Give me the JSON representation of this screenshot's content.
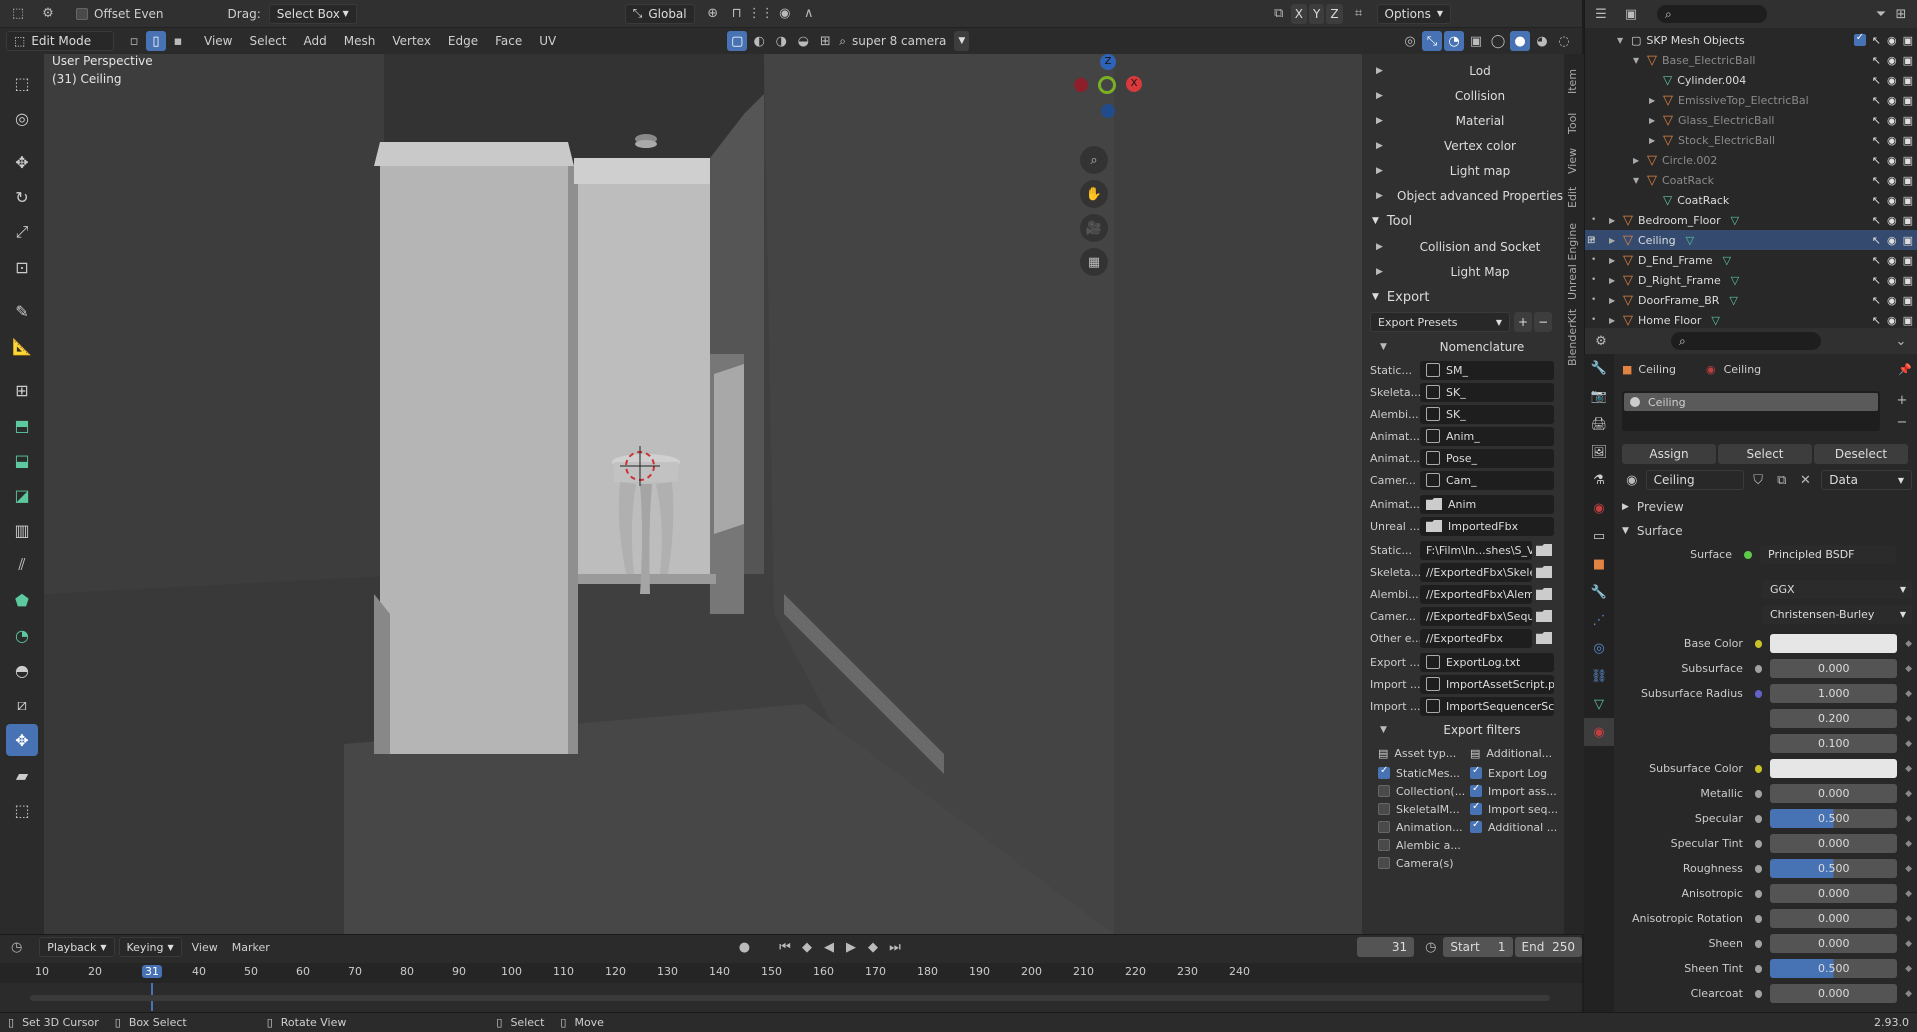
{
  "header": {
    "offset_even": "Offset Even",
    "drag_label": "Drag:",
    "drag_value": "Select Box",
    "transform_orientation": "Global",
    "options": "Options",
    "xyz": [
      "X",
      "Y",
      "Z"
    ]
  },
  "header2": {
    "mode": "Edit Mode",
    "menus": [
      "View",
      "Select",
      "Add",
      "Mesh",
      "Vertex",
      "Edge",
      "Face",
      "UV"
    ],
    "camera": "super 8 camera"
  },
  "viewport": {
    "perspective": "User Perspective",
    "object": "(31) Ceiling"
  },
  "gizmo": {
    "x": "X",
    "y": "Y",
    "z": "Z"
  },
  "npanel": {
    "top_items": [
      "Lod",
      "Collision",
      "Material",
      "Vertex color",
      "Light map",
      "Object advanced Properties"
    ],
    "tool_header": "Tool",
    "tool_items": [
      "Collision and Socket",
      "Light Map"
    ],
    "export_header": "Export",
    "export_presets": "Export Presets",
    "nomenclature": "Nomenclature",
    "prefix_fields": [
      {
        "label": "Static...",
        "value": "SM_"
      },
      {
        "label": "Skeleta...",
        "value": "SK_"
      },
      {
        "label": "Alembi...",
        "value": "SK_"
      },
      {
        "label": "Animat...",
        "value": "Anim_"
      },
      {
        "label": "Animat...",
        "value": "Pose_"
      },
      {
        "label": "Camer...",
        "value": "Cam_"
      }
    ],
    "folder_fields": [
      {
        "label": "Animat...",
        "value": "Anim"
      },
      {
        "label": "Unreal ...",
        "value": "ImportedFbx"
      }
    ],
    "path_fields": [
      {
        "label": "Static...",
        "value": "F:\\Film\\In...shes\\S_V3\\"
      },
      {
        "label": "Skeleta...",
        "value": "//ExportedFbx\\Skele..."
      },
      {
        "label": "Alembi...",
        "value": "//ExportedFbx\\Alem..."
      },
      {
        "label": "Camer...",
        "value": "//ExportedFbx\\Sequ..."
      },
      {
        "label": "Other e...",
        "value": "//ExportedFbx"
      }
    ],
    "file_fields": [
      {
        "label": "Export ...",
        "value": "ExportLog.txt"
      },
      {
        "label": "Import ...",
        "value": "ImportAssetScript.py"
      },
      {
        "label": "Import ...",
        "value": "ImportSequencerSc..."
      }
    ],
    "export_filters": "Export filters",
    "asset_type": "Asset typ...",
    "additional": "Additional...",
    "filters_left": [
      {
        "label": "StaticMes...",
        "on": true
      },
      {
        "label": "Collection(...",
        "on": false
      },
      {
        "label": "SkeletalM...",
        "on": false
      },
      {
        "label": "Animation...",
        "on": false
      },
      {
        "label": "Alembic a...",
        "on": false
      },
      {
        "label": "Camera(s)",
        "on": false
      }
    ],
    "filters_right": [
      {
        "label": "Export Log",
        "on": true
      },
      {
        "label": "Import ass...",
        "on": true
      },
      {
        "label": "Import seq...",
        "on": true
      },
      {
        "label": "Additional ...",
        "on": true
      }
    ]
  },
  "ntabs": [
    "Item",
    "Tool",
    "View",
    "Edit",
    "Unreal Engine",
    "BlenderKit"
  ],
  "outliner": {
    "rows": [
      {
        "name": "SKP Mesh Objects",
        "indent": 2,
        "type": "collection"
      },
      {
        "name": "Base_ElectricBall",
        "indent": 3,
        "type": "obj",
        "dim": true
      },
      {
        "name": "Cylinder.004",
        "indent": 4,
        "type": "mesh"
      },
      {
        "name": "EmissiveTop_ElectricBal",
        "indent": 4,
        "type": "obj",
        "dim": true
      },
      {
        "name": "Glass_ElectricBall",
        "indent": 4,
        "type": "obj",
        "dim": true
      },
      {
        "name": "Stock_ElectricBall",
        "indent": 4,
        "type": "obj",
        "dim": true
      },
      {
        "name": "Circle.002",
        "indent": 3,
        "type": "obj",
        "dim": true
      },
      {
        "name": "CoatRack",
        "indent": 3,
        "type": "obj",
        "dim": true
      },
      {
        "name": "CoatRack",
        "indent": 4,
        "type": "mesh"
      },
      {
        "name": "Bedroom_Floor",
        "indent": 1,
        "type": "obj"
      },
      {
        "name": "Ceiling",
        "indent": 1,
        "type": "obj",
        "selected": true
      },
      {
        "name": "D_End_Frame",
        "indent": 1,
        "type": "obj"
      },
      {
        "name": "D_Right_Frame",
        "indent": 1,
        "type": "obj"
      },
      {
        "name": "DoorFrame_BR",
        "indent": 1,
        "type": "obj"
      },
      {
        "name": "Home Floor",
        "indent": 1,
        "type": "obj"
      }
    ]
  },
  "props": {
    "breadcrumb_obj": "Ceiling",
    "breadcrumb_mat": "Ceiling",
    "slot": "Ceiling",
    "assign": "Assign",
    "select": "Select",
    "deselect": "Deselect",
    "material_name": "Ceiling",
    "link": "Data",
    "preview": "Preview",
    "surface_header": "Surface",
    "surface_label": "Surface",
    "surface_value": "Principled BSDF",
    "distribution": "GGX",
    "subsurface_method": "Christensen-Burley",
    "rows": [
      {
        "label": "Base Color",
        "value": "",
        "kind": "white",
        "dot": "#c7c229"
      },
      {
        "label": "Subsurface",
        "value": "0.000",
        "kind": "num",
        "dot": "#a1a1a1"
      },
      {
        "label": "Subsurface Radius",
        "value": "1.000",
        "kind": "num",
        "dot": "#6363c7"
      },
      {
        "label": "",
        "value": "0.200",
        "kind": "num",
        "dot": ""
      },
      {
        "label": "",
        "value": "0.100",
        "kind": "num",
        "dot": ""
      },
      {
        "label": "Subsurface Color",
        "value": "",
        "kind": "white",
        "dot": "#c7c229"
      },
      {
        "label": "Metallic",
        "value": "0.000",
        "kind": "num",
        "dot": "#a1a1a1"
      },
      {
        "label": "Specular",
        "value": "0.500",
        "kind": "blue",
        "dot": "#a1a1a1"
      },
      {
        "label": "Specular Tint",
        "value": "0.000",
        "kind": "num",
        "dot": "#a1a1a1"
      },
      {
        "label": "Roughness",
        "value": "0.500",
        "kind": "blue",
        "dot": "#a1a1a1"
      },
      {
        "label": "Anisotropic",
        "value": "0.000",
        "kind": "num",
        "dot": "#a1a1a1"
      },
      {
        "label": "Anisotropic Rotation",
        "value": "0.000",
        "kind": "num",
        "dot": "#a1a1a1"
      },
      {
        "label": "Sheen",
        "value": "0.000",
        "kind": "num",
        "dot": "#a1a1a1"
      },
      {
        "label": "Sheen Tint",
        "value": "0.500",
        "kind": "blue",
        "dot": "#a1a1a1"
      },
      {
        "label": "Clearcoat",
        "value": "0.000",
        "kind": "num",
        "dot": "#a1a1a1"
      }
    ]
  },
  "timeline": {
    "menus": [
      "Playback",
      "Keying",
      "View",
      "Marker"
    ],
    "current": "31",
    "start_label": "Start",
    "start": "1",
    "end_label": "End",
    "end": "250",
    "ruler": [
      "10",
      "20",
      "31",
      "40",
      "50",
      "60",
      "70",
      "80",
      "90",
      "100",
      "110",
      "120",
      "130",
      "140",
      "150",
      "160",
      "170",
      "180",
      "190",
      "200",
      "210",
      "220",
      "230",
      "240"
    ]
  },
  "status": {
    "items": [
      "Set 3D Cursor",
      "Box Select",
      "Rotate View",
      "Select",
      "Move"
    ],
    "version": "2.93.0"
  }
}
